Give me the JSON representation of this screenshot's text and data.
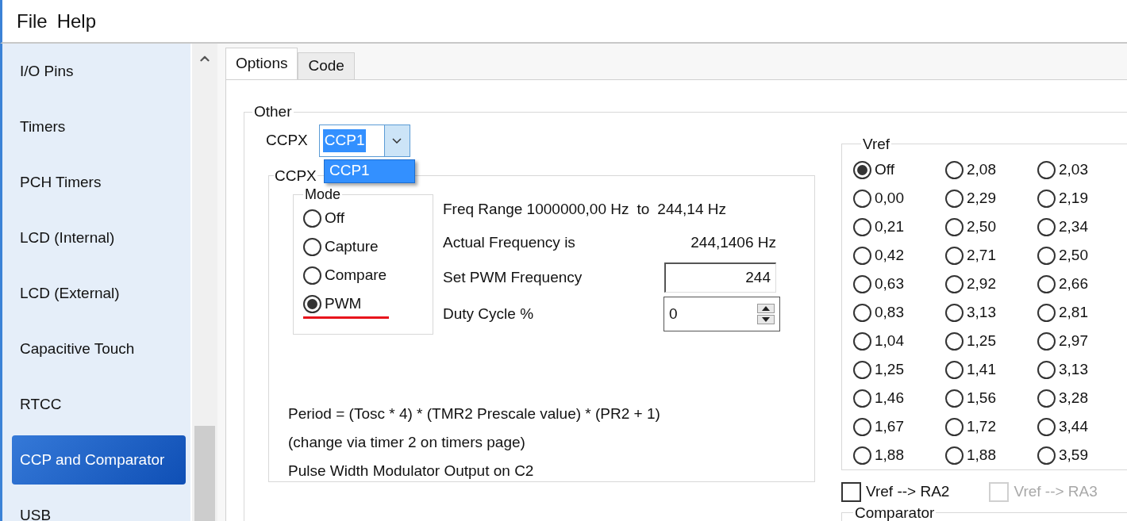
{
  "menu": [
    "File",
    "Help"
  ],
  "sidebar": {
    "items": [
      {
        "label": "I/O Pins",
        "selected": false
      },
      {
        "label": "Timers",
        "selected": false
      },
      {
        "label": "PCH Timers",
        "selected": false
      },
      {
        "label": "LCD (Internal)",
        "selected": false
      },
      {
        "label": "LCD (External)",
        "selected": false
      },
      {
        "label": "Capacitive Touch",
        "selected": false
      },
      {
        "label": "RTCC",
        "selected": false
      },
      {
        "label": "CCP and Comparator",
        "selected": true
      },
      {
        "label": "USB",
        "selected": false
      }
    ]
  },
  "tabs": [
    {
      "label": "Options",
      "selected": true
    },
    {
      "label": "Code",
      "selected": false
    }
  ],
  "other": {
    "legend": "Other",
    "ccpx": {
      "label": "CCPX",
      "value": "CCP1",
      "open_list": [
        {
          "label": "CCP1",
          "selected": true
        }
      ]
    },
    "settings": {
      "legend": "CCPX",
      "mode": {
        "legend": "Mode",
        "options": [
          {
            "label": "Off",
            "selected": false
          },
          {
            "label": "Capture",
            "selected": false
          },
          {
            "label": "Compare",
            "selected": false
          },
          {
            "label": "PWM",
            "selected": true
          }
        ]
      },
      "freq_range": {
        "label": "Freq Range 1000000,00 Hz",
        "to": "to",
        "value": "244,14 Hz"
      },
      "actual_frequency": {
        "label": "Actual Frequency is",
        "value": "244,1406 Hz"
      },
      "set_pwm_frequency": {
        "label": "Set PWM Frequency",
        "value": "244"
      },
      "duty_cycle": {
        "label": "Duty Cycle %",
        "value": "0"
      },
      "notes": [
        "Period = (Tosc * 4) * (TMR2 Prescale value) * (PR2 + 1)",
        "(change via timer 2 on timers page)",
        "Pulse Width Modulator Output on C2"
      ]
    },
    "vref": {
      "legend": "Vref",
      "options": [
        {
          "label": "Off",
          "selected": true
        },
        {
          "label": "2,08",
          "selected": false
        },
        {
          "label": "2,03",
          "selected": false
        },
        {
          "label": "0,00",
          "selected": false
        },
        {
          "label": "2,29",
          "selected": false
        },
        {
          "label": "2,19",
          "selected": false
        },
        {
          "label": "0,21",
          "selected": false
        },
        {
          "label": "2,50",
          "selected": false
        },
        {
          "label": "2,34",
          "selected": false
        },
        {
          "label": "0,42",
          "selected": false
        },
        {
          "label": "2,71",
          "selected": false
        },
        {
          "label": "2,50",
          "selected": false
        },
        {
          "label": "0,63",
          "selected": false
        },
        {
          "label": "2,92",
          "selected": false
        },
        {
          "label": "2,66",
          "selected": false
        },
        {
          "label": "0,83",
          "selected": false
        },
        {
          "label": "3,13",
          "selected": false
        },
        {
          "label": "2,81",
          "selected": false
        },
        {
          "label": "1,04",
          "selected": false
        },
        {
          "label": "1,25",
          "selected": false
        },
        {
          "label": "2,97",
          "selected": false
        },
        {
          "label": "1,25",
          "selected": false
        },
        {
          "label": "1,41",
          "selected": false
        },
        {
          "label": "3,13",
          "selected": false
        },
        {
          "label": "1,46",
          "selected": false
        },
        {
          "label": "1,56",
          "selected": false
        },
        {
          "label": "3,28",
          "selected": false
        },
        {
          "label": "1,67",
          "selected": false
        },
        {
          "label": "1,72",
          "selected": false
        },
        {
          "label": "3,44",
          "selected": false
        },
        {
          "label": "1,88",
          "selected": false
        },
        {
          "label": "1,88",
          "selected": false
        },
        {
          "label": "3,59",
          "selected": false
        }
      ]
    },
    "outputs": [
      {
        "label": "Vref --> RA2",
        "checked": false,
        "disabled": false
      },
      {
        "label": "Vref --> RA3",
        "checked": false,
        "disabled": true
      }
    ],
    "comparator": {
      "legend": "Comparator"
    }
  }
}
